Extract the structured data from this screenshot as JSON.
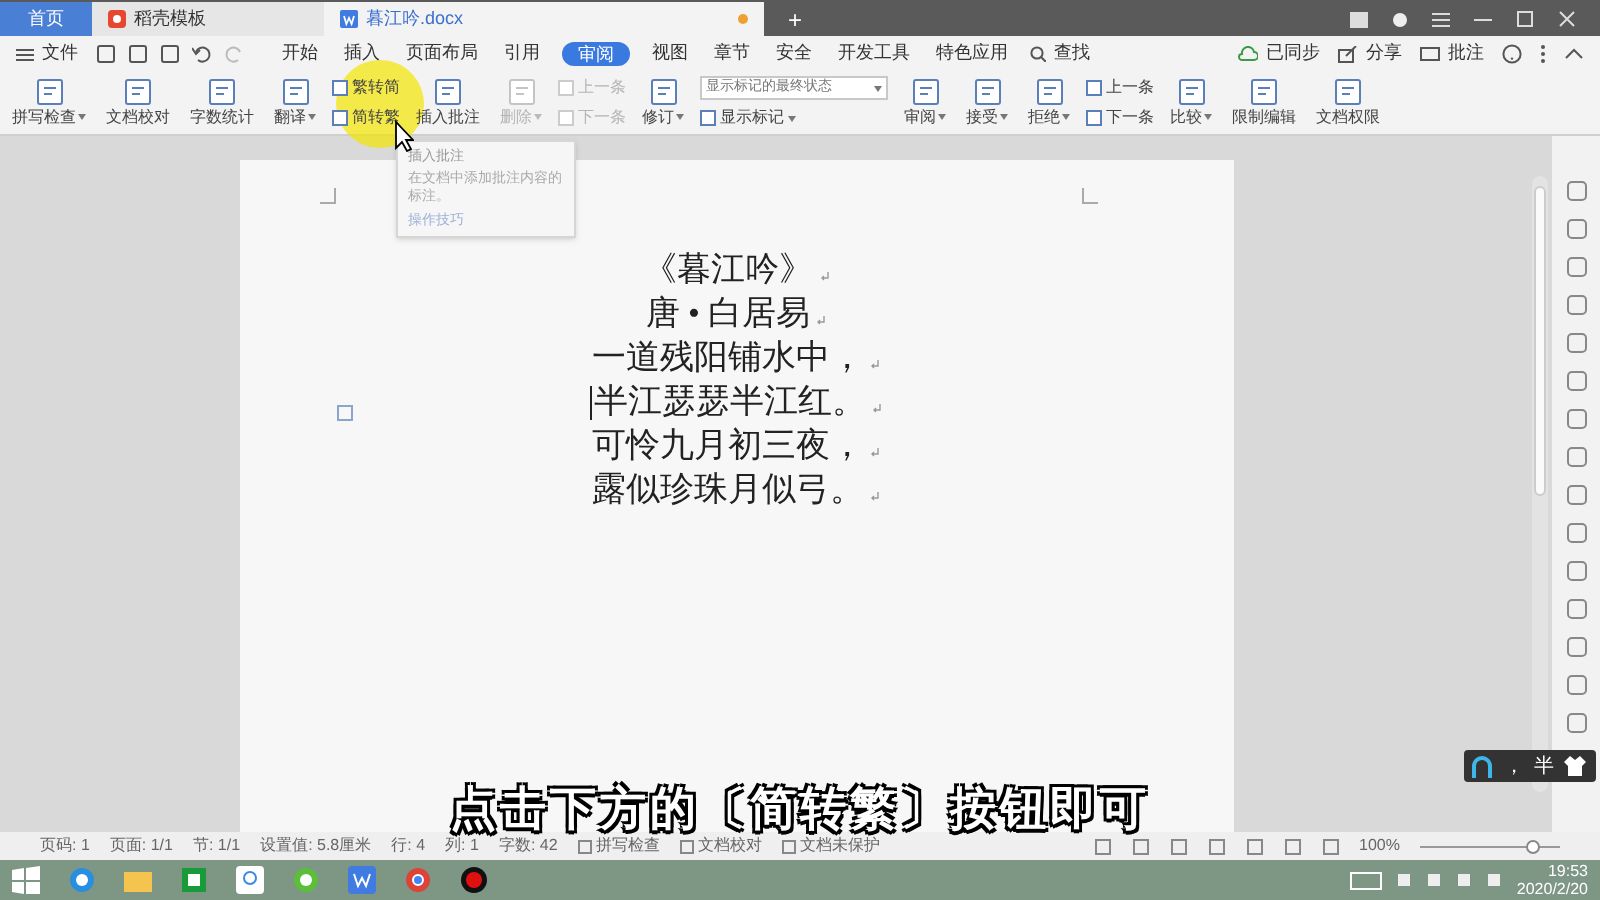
{
  "tabs": [
    {
      "label": "首页",
      "selected": false,
      "kind": "home"
    },
    {
      "label": "稻壳模板",
      "selected": false,
      "kind": "template"
    },
    {
      "label": "暮江吟.docx",
      "selected": true,
      "kind": "doc"
    }
  ],
  "new_tab": "+",
  "menu": {
    "file": "文件",
    "items": [
      {
        "label": "开始",
        "selected": false
      },
      {
        "label": "插入",
        "selected": false
      },
      {
        "label": "页面布局",
        "selected": false
      },
      {
        "label": "引用",
        "selected": false
      },
      {
        "label": "审阅",
        "selected": true
      },
      {
        "label": "视图",
        "selected": false
      },
      {
        "label": "章节",
        "selected": false
      },
      {
        "label": "安全",
        "selected": false
      },
      {
        "label": "开发工具",
        "selected": false
      },
      {
        "label": "特色应用",
        "selected": false
      }
    ],
    "search": "查找",
    "sync": "已同步",
    "share": "分享",
    "comment": "批注"
  },
  "ribbon": [
    {
      "kind": "big",
      "label": "拼写检查",
      "dropdown": true,
      "disabled": false
    },
    {
      "kind": "big",
      "label": "文档校对",
      "dropdown": false,
      "disabled": false
    },
    {
      "kind": "big",
      "label": "字数统计",
      "dropdown": false,
      "disabled": false
    },
    {
      "kind": "big",
      "label": "翻译",
      "dropdown": true,
      "disabled": false
    },
    {
      "kind": "stack",
      "items": [
        {
          "kind": "small",
          "label": "繁转简",
          "dropdown": false,
          "disabled": false
        },
        {
          "kind": "small",
          "label": "简转繁",
          "dropdown": false,
          "disabled": false
        }
      ]
    },
    {
      "kind": "big",
      "label": "插入批注",
      "dropdown": false,
      "disabled": false
    },
    {
      "kind": "big",
      "label": "删除",
      "dropdown": true,
      "disabled": true
    },
    {
      "kind": "stack",
      "items": [
        {
          "kind": "small",
          "label": "上一条",
          "dropdown": false,
          "disabled": true
        },
        {
          "kind": "small",
          "label": "下一条",
          "dropdown": false,
          "disabled": true
        }
      ]
    },
    {
      "kind": "big",
      "label": "修订",
      "dropdown": true,
      "disabled": false
    },
    {
      "kind": "stack",
      "items": [
        {
          "kind": "select",
          "label": "显示标记的最终状态",
          "dropdown": true,
          "disabled": false
        },
        {
          "kind": "small",
          "label": "显示标记",
          "dropdown": true,
          "disabled": false
        }
      ]
    },
    {
      "kind": "big",
      "label": "审阅",
      "dropdown": true,
      "disabled": false
    },
    {
      "kind": "big",
      "label": "接受",
      "dropdown": true,
      "disabled": false
    },
    {
      "kind": "big",
      "label": "拒绝",
      "dropdown": true,
      "disabled": false
    },
    {
      "kind": "stack",
      "items": [
        {
          "kind": "small",
          "label": "上一条",
          "dropdown": false,
          "disabled": false
        },
        {
          "kind": "small",
          "label": "下一条",
          "dropdown": false,
          "disabled": false
        }
      ]
    },
    {
      "kind": "big",
      "label": "比较",
      "dropdown": true,
      "disabled": false
    },
    {
      "kind": "big",
      "label": "限制编辑",
      "dropdown": false,
      "disabled": false
    },
    {
      "kind": "big",
      "label": "文档权限",
      "dropdown": false,
      "disabled": false
    }
  ],
  "tooltip": {
    "title": "插入批注",
    "body": "在文档中添加批注内容的标注。",
    "link": "操作技巧"
  },
  "document": {
    "lines": [
      "《暮江吟》",
      "唐 • 白居易",
      "一道残阳铺水中，",
      "半江瑟瑟半江红。",
      "可怜九月初三夜，",
      "露似珍珠月似弓。"
    ]
  },
  "status_bar": {
    "fields": [
      "页码: 1",
      "页面: 1/1",
      "节: 1/1",
      "设置值: 5.8厘米",
      "行: 4",
      "列: 1",
      "字数: 42"
    ],
    "toggles": [
      "拼写检查",
      "文档校对",
      "文档未保护"
    ],
    "zoom": "100%",
    "zoom_slider": {
      "level": 0.8
    }
  },
  "subtitle": "点击下方的〔简转繁〕按钮即可",
  "ime": {
    "punct": "，",
    "width": "半"
  },
  "clock": {
    "time": "19:53",
    "date": "2020/2/20"
  }
}
